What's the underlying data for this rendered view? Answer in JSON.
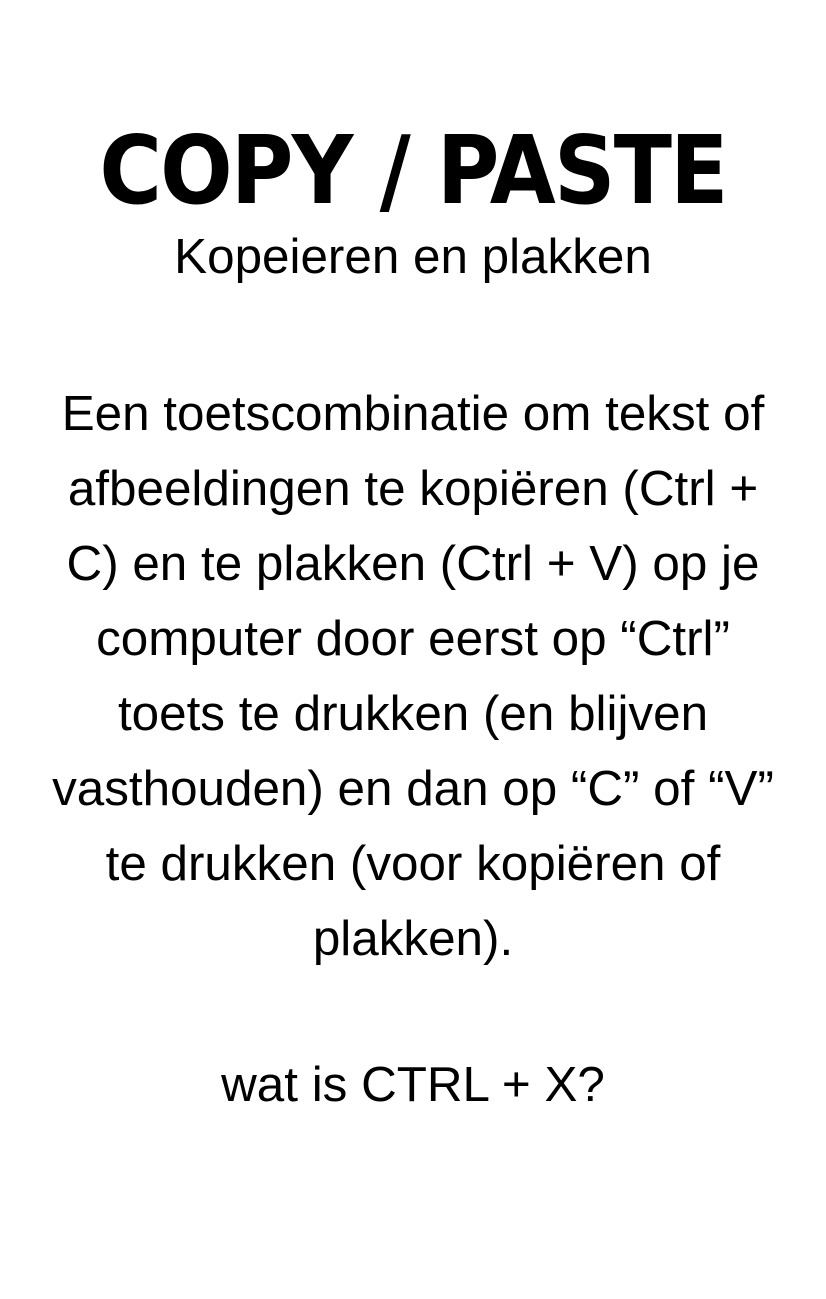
{
  "title": "COPY / PASTE",
  "subtitle": "Kopeieren en plakken",
  "body_lines": [
    "Een toetscombinatie om tekst of",
    "afbeeldingen te kopiëren (Ctrl +",
    "C) en te plakken (Ctrl + V) op je",
    "computer door eerst op “Ctrl”",
    "toets te drukken (en blijven",
    "vasthouden) en dan op “C” of “V”",
    "te drukken (voor kopiëren of",
    "plakken)."
  ],
  "question": "wat is CTRL + X?",
  "colors": {
    "background": "#ffffff",
    "text": "#000000"
  }
}
